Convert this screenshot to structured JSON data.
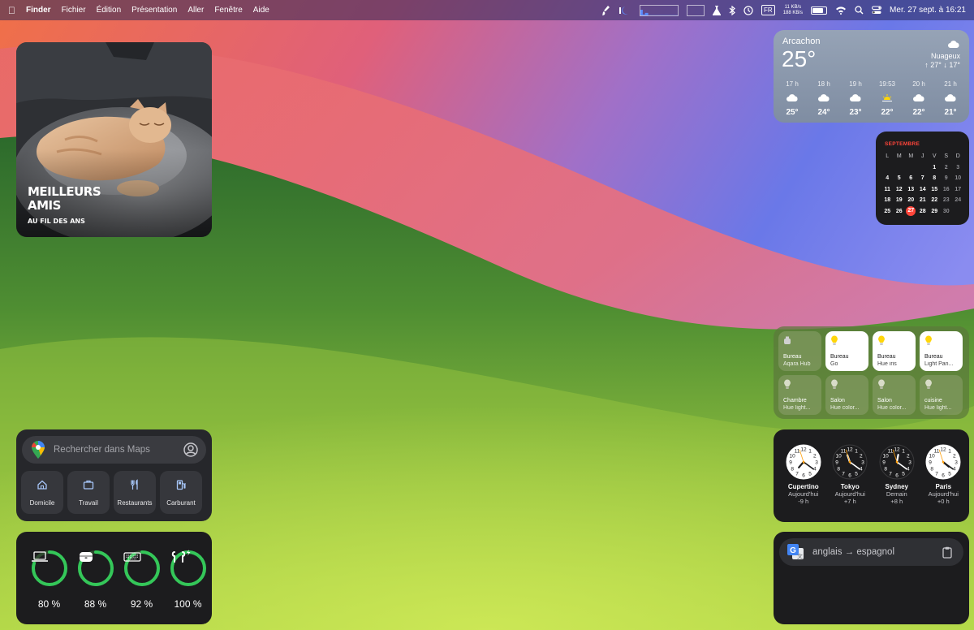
{
  "menubar": {
    "app_name": "Finder",
    "menus": [
      "Fichier",
      "Édition",
      "Présentation",
      "Aller",
      "Fenêtre",
      "Aide"
    ],
    "net_up": "11 KB/s",
    "net_down": "188 KB/s",
    "input_source": "FR",
    "datetime": "Mer. 27 sept. à 16:21",
    "icons": [
      "apple-logo",
      "brush-icon",
      "cpu-icon",
      "moon-icon",
      "flask-icon",
      "bluetooth-icon",
      "time-machine-icon",
      "battery-icon",
      "wifi-icon",
      "search-icon",
      "control-center-icon"
    ]
  },
  "photo": {
    "title_line1": "MEILLEURS",
    "title_line2": "AMIS",
    "subtitle": "AU FIL DES ANS"
  },
  "weather": {
    "city": "Arcachon",
    "temp": "25°",
    "condition": "Nuageux",
    "hilo": "↑ 27° ↓ 17°",
    "hours": [
      {
        "time": "17 h",
        "temp": "25°",
        "icon": "cloud"
      },
      {
        "time": "18 h",
        "temp": "24°",
        "icon": "cloud"
      },
      {
        "time": "19 h",
        "temp": "23°",
        "icon": "cloud"
      },
      {
        "time": "19:53",
        "temp": "22°",
        "icon": "sunset"
      },
      {
        "time": "20 h",
        "temp": "22°",
        "icon": "cloud"
      },
      {
        "time": "21 h",
        "temp": "21°",
        "icon": "cloud"
      }
    ]
  },
  "calendar": {
    "month": "SEPTEMBRE",
    "weekdays": [
      "L",
      "M",
      "M",
      "J",
      "V",
      "S",
      "D"
    ],
    "weeks": [
      [
        "",
        "",
        "",
        "",
        "1",
        "2",
        "3"
      ],
      [
        "4",
        "5",
        "6",
        "7",
        "8",
        "9",
        "10"
      ],
      [
        "11",
        "12",
        "13",
        "14",
        "15",
        "16",
        "17"
      ],
      [
        "18",
        "19",
        "20",
        "21",
        "22",
        "23",
        "24"
      ],
      [
        "25",
        "26",
        "27",
        "28",
        "29",
        "30",
        ""
      ]
    ],
    "today": "27"
  },
  "maps": {
    "placeholder": "Rechercher dans Maps",
    "shortcuts": [
      {
        "label": "Domicile",
        "icon": "home"
      },
      {
        "label": "Travail",
        "icon": "briefcase"
      },
      {
        "label": "Restaurants",
        "icon": "fork-knife"
      },
      {
        "label": "Carburant",
        "icon": "fuel"
      }
    ]
  },
  "batteries": {
    "devices": [
      {
        "icon": "laptop",
        "level": 0.8,
        "label": "80 %"
      },
      {
        "icon": "airpods-case",
        "level": 0.88,
        "label": "88 %"
      },
      {
        "icon": "keyboard",
        "level": 0.92,
        "label": "92 %"
      },
      {
        "icon": "airpods",
        "level": 1.0,
        "label": "100 %"
      }
    ],
    "ring_color": "#34c759"
  },
  "home": {
    "tiles": [
      {
        "name": "Bureau",
        "detail": "Aqara Hub",
        "on": false,
        "icon": "hub"
      },
      {
        "name": "Bureau",
        "detail": "Go",
        "on": true,
        "icon": "bulb"
      },
      {
        "name": "Bureau",
        "detail": "Hue iris",
        "on": true,
        "icon": "bulb"
      },
      {
        "name": "Bureau",
        "detail": "Light Pan...",
        "on": true,
        "icon": "bulb"
      },
      {
        "name": "Chambre",
        "detail": "Hue light...",
        "on": false,
        "icon": "bulb"
      },
      {
        "name": "Salon",
        "detail": "Hue color...",
        "on": false,
        "icon": "bulb"
      },
      {
        "name": "Salon",
        "detail": "Hue color...",
        "on": false,
        "icon": "bulb"
      },
      {
        "name": "cuisine",
        "detail": "Hue light...",
        "on": false,
        "icon": "bulb"
      }
    ]
  },
  "clocks": [
    {
      "city": "Cupertino",
      "day": "Aujourd'hui",
      "offset": "-9 h",
      "hour": 7,
      "minute": 21,
      "light": true
    },
    {
      "city": "Tokyo",
      "day": "Aujourd'hui",
      "offset": "+7 h",
      "hour": 23,
      "minute": 21,
      "light": false
    },
    {
      "city": "Sydney",
      "day": "Demain",
      "offset": "+8 h",
      "hour": 0,
      "minute": 21,
      "light": false
    },
    {
      "city": "Paris",
      "day": "Aujourd'hui",
      "offset": "+0 h",
      "hour": 16,
      "minute": 21,
      "light": true
    }
  ],
  "translate": {
    "text": "anglais → espagnol",
    "logo_letters": "G",
    "logo_alt": "文"
  }
}
